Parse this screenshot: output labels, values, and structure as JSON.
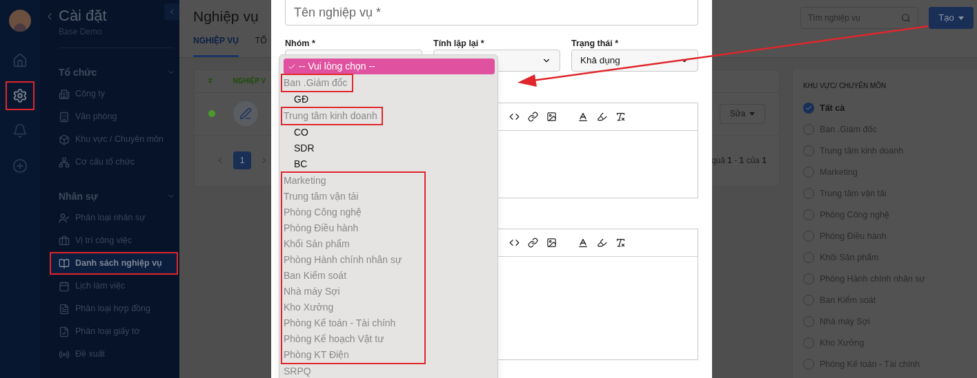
{
  "rail": {
    "items": [
      {
        "kind": "home",
        "selected": false,
        "highlighted": false
      },
      {
        "kind": "settings",
        "selected": true,
        "highlighted": true
      },
      {
        "kind": "notifications",
        "selected": false,
        "highlighted": false
      },
      {
        "kind": "add",
        "selected": false,
        "highlighted": false
      }
    ]
  },
  "sidebar": {
    "title": "Cài đặt",
    "subtitle": "Base Demo",
    "sections": [
      {
        "title": "Tổ chức",
        "expanded": true,
        "items": [
          {
            "label": "Công ty",
            "selected": false,
            "highlighted": false
          },
          {
            "label": "Văn phòng",
            "selected": false,
            "highlighted": false
          },
          {
            "label": "Khu vực / Chuyên môn",
            "selected": false,
            "highlighted": false
          },
          {
            "label": "Cơ cấu tổ chức",
            "selected": false,
            "highlighted": false
          }
        ]
      },
      {
        "title": "Nhân sự",
        "expanded": true,
        "items": [
          {
            "label": "Phân loại nhân sự",
            "selected": false,
            "highlighted": false
          },
          {
            "label": "Vị trí công việc",
            "selected": false,
            "highlighted": false
          },
          {
            "label": "Danh sách nghiệp vụ",
            "selected": true,
            "highlighted": true
          },
          {
            "label": "Lịch làm việc",
            "selected": false,
            "highlighted": false
          },
          {
            "label": "Phân loại hợp đồng",
            "selected": false,
            "highlighted": false
          },
          {
            "label": "Phân loại giấy tờ",
            "selected": false,
            "highlighted": false
          },
          {
            "label": "Đề xuất",
            "selected": false,
            "highlighted": false
          }
        ]
      }
    ]
  },
  "page": {
    "title": "Nghiệp vụ",
    "tabs": [
      {
        "label": "NGHIỆP VỤ",
        "selected": true
      },
      {
        "label": "TỔ",
        "selected": false
      }
    ],
    "search": {
      "placeholder": "Tìm nghiệp vụ"
    },
    "create_button": "Tạo",
    "table": {
      "columns": [
        "#",
        "NGHIỆP V"
      ],
      "rows": [
        {
          "color": "#4b9a2c",
          "action": "Sửa"
        }
      ],
      "pages": [
        {
          "label": "1",
          "selected": true
        }
      ],
      "summary": "quả **1** - **1** của **1**"
    },
    "filter": {
      "title": "KHU VỰC/ CHUYÊN MÔN",
      "options": [
        {
          "label": "Tất cả",
          "selected": true
        },
        {
          "label": "Ban .Giám đốc",
          "selected": false
        },
        {
          "label": "Trung tâm kinh doanh",
          "selected": false
        },
        {
          "label": "Marketing",
          "selected": false
        },
        {
          "label": "Trung tâm vận tải",
          "selected": false
        },
        {
          "label": "Phòng Công nghệ",
          "selected": false
        },
        {
          "label": "Phòng Điều hành",
          "selected": false
        },
        {
          "label": "Khối Sản phẩm",
          "selected": false
        },
        {
          "label": "Phòng Hành chính nhân sự",
          "selected": false
        },
        {
          "label": "Ban Kiểm soát",
          "selected": false
        },
        {
          "label": "Nhà máy Sợi",
          "selected": false
        },
        {
          "label": "Kho Xưởng",
          "selected": false
        },
        {
          "label": "Phòng Kế toán - Tài chính",
          "selected": false
        }
      ]
    }
  },
  "modal": {
    "name_field": {
      "placeholder": "Tên nghiệp vụ *"
    },
    "fields": [
      {
        "label": "Nhóm *"
      },
      {
        "label": "Tính lặp lại *"
      },
      {
        "label": "Trạng thái *",
        "value": "Khả dụng"
      }
    ],
    "dropdown": {
      "items": [
        {
          "kind": "option",
          "label": "-- Vui lòng chọn --",
          "selected": true
        },
        {
          "kind": "group",
          "label": "Ban .Giám đốc",
          "highlighted": true,
          "children": [
            {
              "label": "GĐ",
              "selected": false
            }
          ]
        },
        {
          "kind": "group",
          "label": "Trung tâm kinh doanh",
          "highlighted": true,
          "children": [
            {
              "label": "CO",
              "selected": false
            },
            {
              "label": "SDR",
              "selected": false
            },
            {
              "label": "BC",
              "selected": false
            }
          ]
        },
        {
          "kind": "group",
          "label": "Marketing",
          "highlighted": true
        },
        {
          "kind": "group",
          "label": "Trung tâm vận tải",
          "highlighted": true
        },
        {
          "kind": "group",
          "label": "Phòng Công nghệ",
          "highlighted": true
        },
        {
          "kind": "group",
          "label": "Phòng Điều hành",
          "highlighted": true
        },
        {
          "kind": "group",
          "label": "Khối Sản phẩm",
          "highlighted": true
        },
        {
          "kind": "group",
          "label": "Phòng Hành chính nhân sự",
          "highlighted": true
        },
        {
          "kind": "group",
          "label": "Ban Kiểm soát",
          "highlighted": true
        },
        {
          "kind": "group",
          "label": "Nhà máy Sợi",
          "highlighted": true
        },
        {
          "kind": "group",
          "label": "Kho Xưởng",
          "highlighted": true
        },
        {
          "kind": "group",
          "label": "Phòng Kế toán - Tài chính",
          "highlighted": true
        },
        {
          "kind": "group",
          "label": "Phòng Kế hoạch Vật tư",
          "highlighted": true
        },
        {
          "kind": "group",
          "label": "Phòng KT Điện",
          "highlighted": true
        },
        {
          "kind": "group",
          "label": "SRPQ",
          "highlighted": false
        }
      ]
    }
  }
}
